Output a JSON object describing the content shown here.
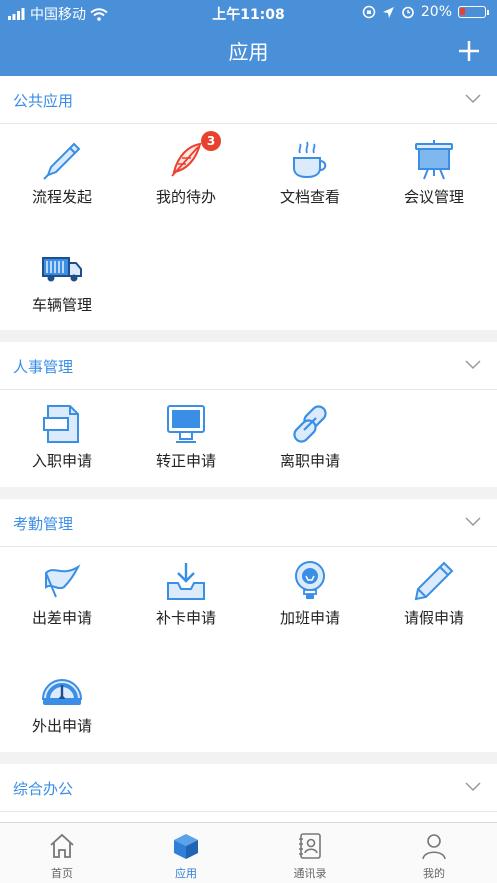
{
  "status_bar": {
    "carrier": "中国移动",
    "time": "上午11:08",
    "battery": "20%"
  },
  "nav": {
    "title": "应用"
  },
  "sections": [
    {
      "title": "公共应用",
      "apps": [
        {
          "label": "流程发起",
          "icon": "pen-icon"
        },
        {
          "label": "我的待办",
          "icon": "feather-icon",
          "badge": "3"
        },
        {
          "label": "文档查看",
          "icon": "coffee-cup-icon"
        },
        {
          "label": "会议管理",
          "icon": "projector-screen-icon"
        },
        {
          "label": "车辆管理",
          "icon": "truck-icon"
        }
      ]
    },
    {
      "title": "人事管理",
      "apps": [
        {
          "label": "入职申请",
          "icon": "document-icon"
        },
        {
          "label": "转正申请",
          "icon": "monitor-icon"
        },
        {
          "label": "离职申请",
          "icon": "link-icon"
        }
      ]
    },
    {
      "title": "考勤管理",
      "apps": [
        {
          "label": "出差申请",
          "icon": "flag-icon"
        },
        {
          "label": "补卡申请",
          "icon": "download-tray-icon"
        },
        {
          "label": "加班申请",
          "icon": "lightbulb-icon"
        },
        {
          "label": "请假申请",
          "icon": "pencil-icon"
        },
        {
          "label": "外出申请",
          "icon": "speedometer-icon"
        }
      ]
    },
    {
      "title": "综合办公",
      "apps": []
    }
  ],
  "tabs": [
    {
      "label": "首页",
      "icon": "home-icon",
      "active": false
    },
    {
      "label": "应用",
      "icon": "cube-icon",
      "active": true
    },
    {
      "label": "通讯录",
      "icon": "contacts-icon",
      "active": false
    },
    {
      "label": "我的",
      "icon": "user-icon",
      "active": false
    }
  ],
  "colors": {
    "primary": "#4a90d9",
    "section_title": "#3a8ee6",
    "icon_blue": "#3a8ee6",
    "badge_red": "#e8412d",
    "background": "#f2f2f2"
  }
}
